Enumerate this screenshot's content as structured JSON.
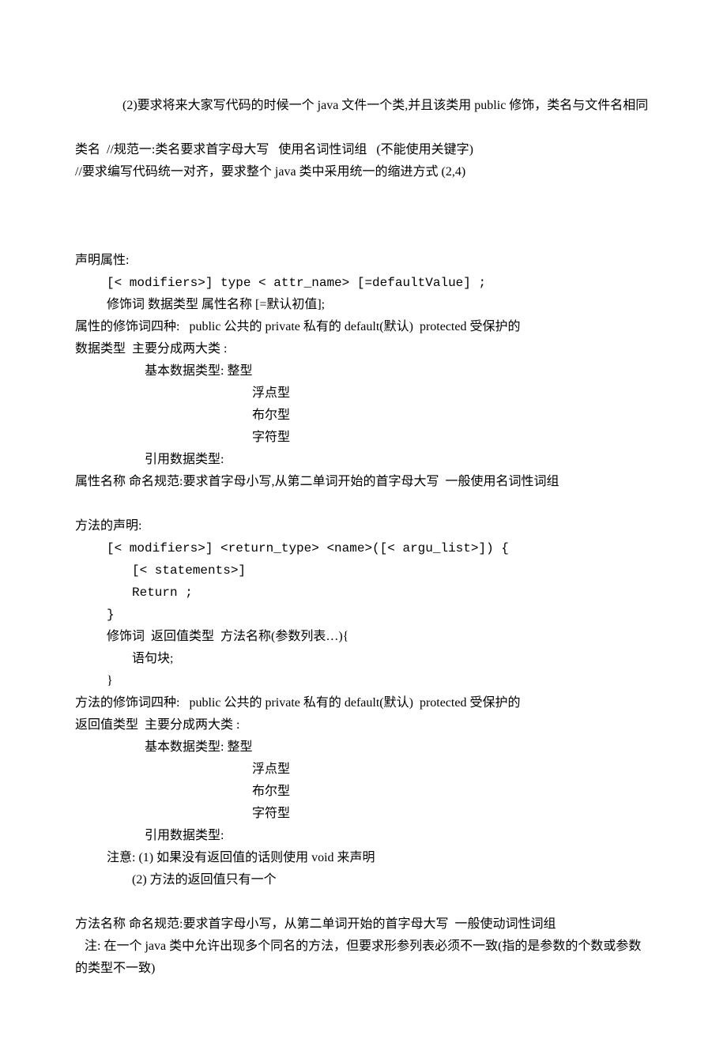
{
  "lines": {
    "l1": "(2)要求将来大家写代码的时候一个 java 文件一个类,并且该类用 public 修饰，类名与文件名相同",
    "l2": "类名  //规范一:类名要求首字母大写   使用名词性词组   (不能使用关键字)",
    "l3": "//要求编写代码统一对齐，要求整个 java 类中采用统一的缩进方式 (2,4)",
    "l4": "声明属性:",
    "l5": "[< modifiers>] type < attr_name> [=defaultValue] ;",
    "l6": "修饰词 数据类型 属性名称 [=默认初值];",
    "l7": "属性的修饰词四种:   public 公共的 private 私有的 default(默认)  protected 受保护的",
    "l8": "数据类型  主要分成两大类 :",
    "l9": "基本数据类型: 整型",
    "l10": "浮点型",
    "l11": "布尔型",
    "l12": "字符型",
    "l13": "引用数据类型:",
    "l14": "属性名称 命名规范:要求首字母小写,从第二单词开始的首字母大写  一般使用名词性词组",
    "l15": "方法的声明:",
    "l16": "[< modifiers>] <return_type> <name>([< argu_list>]) {",
    "l17": "[< statements>]",
    "l18": "Return ;",
    "l19": "}",
    "l20": "修饰词  返回值类型  方法名称(参数列表…){",
    "l21": "语句块;",
    "l22": "}",
    "l23": "方法的修饰词四种:   public 公共的 private 私有的 default(默认)  protected 受保护的",
    "l24": "返回值类型  主要分成两大类 :",
    "l25": "基本数据类型: 整型",
    "l26": "浮点型",
    "l27": "布尔型",
    "l28": "字符型",
    "l29": "引用数据类型:",
    "l30": "注意: (1) 如果没有返回值的话则使用 void 来声明",
    "l31": "(2) 方法的返回值只有一个",
    "l32": "方法名称 命名规范:要求首字母小写，从第二单词开始的首字母大写  一般使动词性词组",
    "l33": "   注: 在一个 java 类中允许出现多个同名的方法，但要求形参列表必须不一致(指的是参数的个数或参数的类型不一致)"
  }
}
